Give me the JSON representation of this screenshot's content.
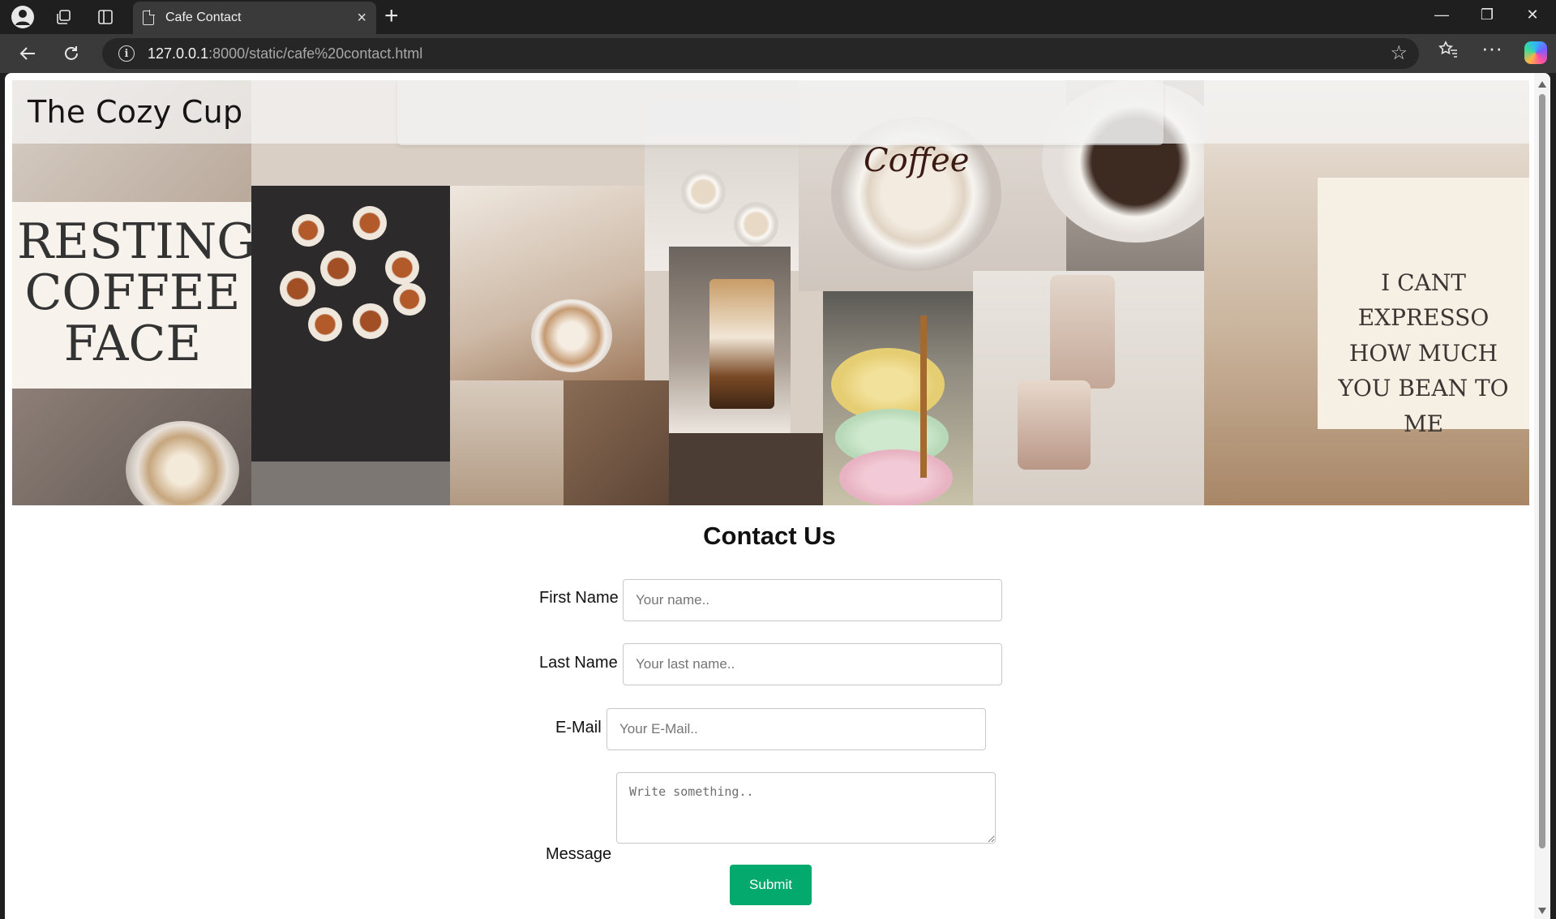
{
  "browser": {
    "tab_title": "Cafe Contact",
    "tab_close": "×",
    "new_tab": "+",
    "url_host": "127.0.0.1",
    "url_rest": ":8000/static/cafe%20contact.html",
    "window_controls": {
      "minimize": "—",
      "restore": "❐",
      "close": "✕"
    }
  },
  "site": {
    "title": "The Cozy Cup"
  },
  "hero_signs": {
    "left": "RESTING COFFEE FACE",
    "mug": "Coffee",
    "right": "I CANT EXPRESSO HOW MUCH YOU BEAN TO ME"
  },
  "contact": {
    "heading": "Contact Us",
    "first_name_label": "First Name",
    "first_name_placeholder": "Your name..",
    "last_name_label": "Last Name",
    "last_name_placeholder": "Your last name..",
    "email_label": "E-Mail",
    "email_placeholder": "Your E-Mail..",
    "message_label": "Message",
    "message_placeholder": "Write something..",
    "submit_label": "Submit"
  },
  "colors": {
    "submit_bg": "#04aa6d",
    "chrome_bg": "#1f1f1f",
    "toolbar_bg": "#3a3a3a"
  }
}
